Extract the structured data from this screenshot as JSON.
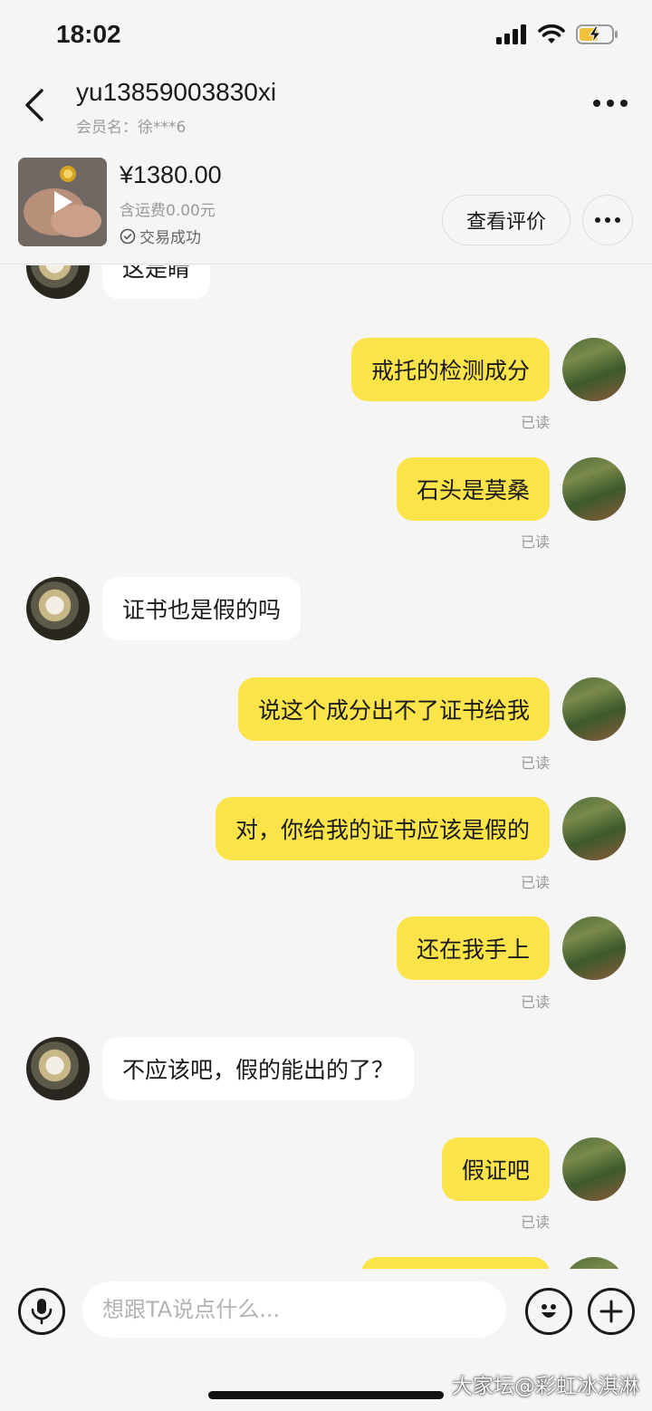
{
  "status_bar": {
    "time": "18:02"
  },
  "header": {
    "title": "yu13859003830xi",
    "subtitle": "会员名：徐***6"
  },
  "product": {
    "price": "¥1380.00",
    "shipping": "含运费0.00元",
    "status": "交易成功",
    "review_label": "查看评价"
  },
  "messages": [
    {
      "side": "other",
      "text": "这是睛"
    },
    {
      "side": "me",
      "text": "戒托的检测成分",
      "read": "已读"
    },
    {
      "side": "me",
      "text": "石头是莫桑",
      "read": "已读"
    },
    {
      "side": "other",
      "text": "证书也是假的吗"
    },
    {
      "side": "me",
      "text": "说这个成分出不了证书给我",
      "read": "已读"
    },
    {
      "side": "me",
      "text": "对，你给我的证书应该是假的",
      "read": "已读"
    },
    {
      "side": "me",
      "text": "还在我手上",
      "read": "已读"
    },
    {
      "side": "other",
      "text": "不应该吧，假的能出的了？"
    },
    {
      "side": "me",
      "text": "假证吧",
      "read": "已读"
    },
    {
      "side": "me",
      "text": ""
    }
  ],
  "input": {
    "placeholder": "想跟TA说点什么..."
  },
  "watermark": "大家坛@彩虹冰淇淋",
  "colors": {
    "my_bubble": "#fbe34a",
    "other_bubble": "#ffffff",
    "background": "#f5f5f5"
  }
}
